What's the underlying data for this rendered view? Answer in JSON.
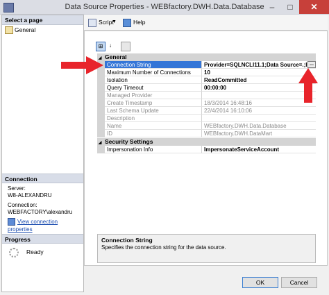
{
  "window": {
    "title": "Data Source Properties - WEBfactory.DWH.Data.Database"
  },
  "left_pane": {
    "select_page_label": "Select a page",
    "pages": [
      {
        "label": "General"
      }
    ],
    "connection": {
      "header": "Connection",
      "server_label": "Server:",
      "server_value": "W8-ALEXANDRU",
      "connection_label": "Connection:",
      "connection_value": "WEBFACTORY\\alexandru",
      "view_link": "View connection properties"
    },
    "progress": {
      "header": "Progress",
      "status": "Ready"
    }
  },
  "toolbar": {
    "script_label": "Script",
    "help_label": "Help"
  },
  "grid": {
    "categories": [
      {
        "label": "General",
        "rows": [
          {
            "name": "Connection String",
            "value": "Provider=SQLNCLI11.1;Data Source=.;I",
            "selected": true,
            "bold": true,
            "gray": false
          },
          {
            "name": "Maximum Number of Connections",
            "value": "10",
            "bold": true,
            "gray": false
          },
          {
            "name": "Isolation",
            "value": "ReadCommitted",
            "bold": true,
            "gray": false
          },
          {
            "name": "Query Timeout",
            "value": "00:00:00",
            "bold": true,
            "gray": false
          },
          {
            "name": "Managed Provider",
            "value": "",
            "bold": false,
            "gray": true
          },
          {
            "name": "Create Timestamp",
            "value": "18/3/2014 16:48:16",
            "bold": false,
            "gray": true
          },
          {
            "name": "Last Schema Update",
            "value": "22/4/2014 16:10:06",
            "bold": false,
            "gray": true
          },
          {
            "name": "Description",
            "value": "",
            "bold": false,
            "gray": true
          },
          {
            "name": "Name",
            "value": "WEBfactory.DWH.Data.Database",
            "bold": false,
            "gray": true
          },
          {
            "name": "ID",
            "value": "WEBfactory.DWH.DataMart",
            "bold": false,
            "gray": true
          }
        ]
      },
      {
        "label": "Security Settings",
        "rows": [
          {
            "name": "Impersonation Info",
            "value": "ImpersonateServiceAccount",
            "bold": true,
            "gray": false
          }
        ]
      }
    ],
    "ellipsis": "..."
  },
  "description": {
    "title": "Connection String",
    "text": "Specifies the connection string for the data source."
  },
  "buttons": {
    "ok": "OK",
    "cancel": "Cancel"
  },
  "colors": {
    "selection": "#3375d7",
    "arrow": "#e8242b"
  }
}
